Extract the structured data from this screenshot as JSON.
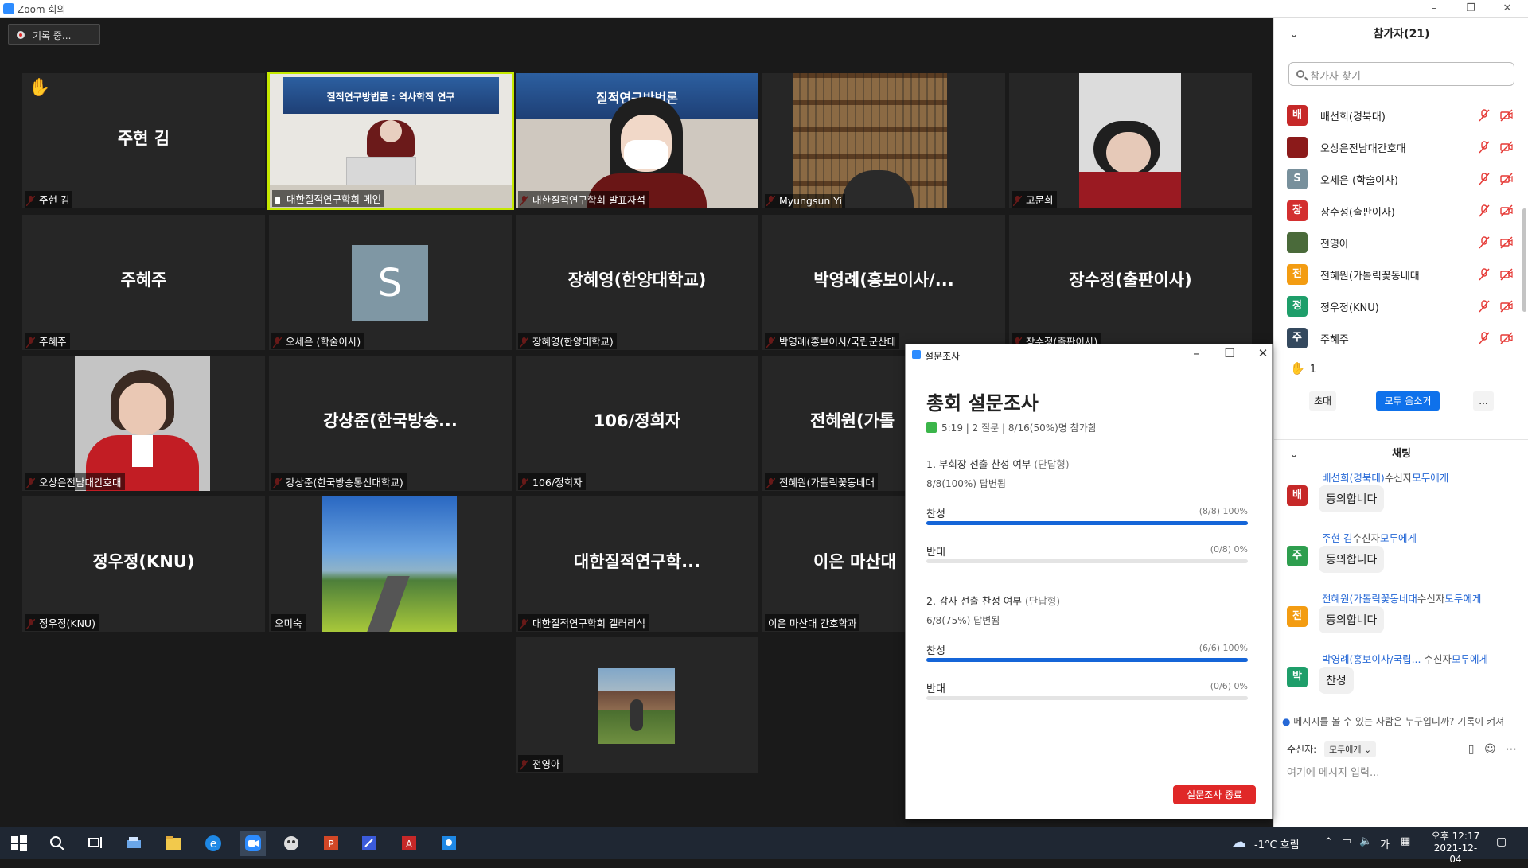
{
  "window": {
    "title": "Zoom 회의",
    "minimize": "–",
    "restore": "❐",
    "close": "✕"
  },
  "recording": {
    "label": "기록 중..."
  },
  "tiles": [
    {
      "big": "주현 김",
      "name": "주현 김",
      "muted": true,
      "hand": true
    },
    {
      "name": "대한질적연구학회 메인",
      "muted": false,
      "active": true,
      "banner": "질적연구방법론 : 역사학적 연구"
    },
    {
      "name": "대한질적연구학회 발표자석",
      "muted": true,
      "banner": "질적연구방법론",
      "banner2": "연구"
    },
    {
      "name": "Myungsun Yi",
      "muted": true
    },
    {
      "name": "고문희",
      "muted": true
    },
    {
      "big": "주혜주",
      "name": "주혜주",
      "muted": true
    },
    {
      "avatar_letter": "S",
      "name": "오세은 (학술이사)",
      "muted": true
    },
    {
      "big": "장혜영(한양대학교)",
      "name": "장혜영(한양대학교)",
      "muted": true
    },
    {
      "big": "박영례(홍보이사/...",
      "name": "박영례(홍보이사/국립군산대",
      "muted": true
    },
    {
      "big": "장수정(출판이사)",
      "name": "장수정(출판이사)",
      "muted": true
    },
    {
      "name": "오상은전남대간호대",
      "muted": true
    },
    {
      "big": "강상준(한국방송...",
      "name": "강상준(한국방송통신대학교)",
      "muted": true
    },
    {
      "big": "106/정희자",
      "name": "106/정희자",
      "muted": true
    },
    {
      "big": "전혜원(가톨",
      "name": "전혜원(가톨릭꽃동네대",
      "muted": true
    },
    {
      "big": "정우정(KNU)",
      "name": "정우정(KNU)",
      "muted": true
    },
    {
      "name": "오미숙",
      "muted": false
    },
    {
      "big": "대한질적연구학...",
      "name": "대한질적연구학회 갤러리석",
      "muted": true
    },
    {
      "big": "이은 마산대",
      "name": "이은 마산대 간호학과",
      "muted": false
    },
    {
      "name": "전영아",
      "muted": true
    }
  ],
  "participants": {
    "header": "참가자(21)",
    "search_placeholder": "참가자 찾기",
    "list": [
      {
        "initial": "배",
        "name": "배선희(경북대)",
        "color": "#c62828"
      },
      {
        "initial": "",
        "name": "오상은전남대간호대",
        "color": "#8b1a1a"
      },
      {
        "initial": "S",
        "name": "오세은 (학술이사)",
        "color": "#78909c"
      },
      {
        "initial": "장",
        "name": "장수정(출판이사)",
        "color": "#d32f2f"
      },
      {
        "initial": "",
        "name": "전영아",
        "color": "#4a6a3a"
      },
      {
        "initial": "전",
        "name": "전혜원(가톨릭꽃동네대",
        "color": "#f39c12"
      },
      {
        "initial": "정",
        "name": "정우정(KNU)",
        "color": "#1e9e6a"
      },
      {
        "initial": "주",
        "name": "주혜주",
        "color": "#34495e"
      }
    ],
    "hands_count": "1",
    "invite": "초대",
    "mute_all": "모두 음소거",
    "more": "..."
  },
  "chat": {
    "header": "채팅",
    "messages": [
      {
        "initial": "배",
        "color": "#c62828",
        "from": "배선희(경북대)",
        "to_label": "수신자",
        "to": "모두에게",
        "text": "동의합니다"
      },
      {
        "initial": "주",
        "color": "#2e9e4e",
        "from": "주현 김",
        "to_label": "수신자",
        "to": "모두에게",
        "text": "동의합니다"
      },
      {
        "initial": "전",
        "color": "#f39c12",
        "from": "전혜원(가톨릭꽃동네대",
        "to_label": "수신자",
        "to": "모두에게",
        "text": "동의합니다"
      },
      {
        "initial": "박",
        "color": "#1e9e6a",
        "from": "박영례(홍보이사/국립...",
        "to_label": " 수신자",
        "to": "모두에게",
        "text": "찬성"
      }
    ],
    "note": "메시지를 볼 수 있는 사람은 누구입니까? 기록이 켜져",
    "to_label": "수신자:",
    "to_value": "모두에게",
    "input_placeholder": "여기에 메시지 입력..."
  },
  "poll": {
    "window_title": "설문조사",
    "title": "총회 설문조사",
    "meta": "5:19  |  2 질문  |  8/16(50%)명 참가함",
    "questions": [
      {
        "title": "1. 부회장 선출 찬성 여부",
        "type": "(단답형)",
        "answered": "8/8(100%) 답변됨",
        "options": [
          {
            "label": "찬성",
            "value_text": "(8/8) 100%",
            "fraction": 1.0
          },
          {
            "label": "반대",
            "value_text": "(0/8) 0%",
            "fraction": 0.0
          }
        ]
      },
      {
        "title": "2. 감사 선출 찬성 여부",
        "type": "(단답형)",
        "answered": "6/8(75%) 답변됨",
        "options": [
          {
            "label": "찬성",
            "value_text": "(6/6) 100%",
            "fraction": 1.0
          },
          {
            "label": "반대",
            "value_text": "(0/6) 0%",
            "fraction": 0.0
          }
        ]
      }
    ],
    "end_button": "설문조사 종료"
  },
  "taskbar": {
    "weather": "-1°C  흐림",
    "ime": "가",
    "time": "오후 12:17",
    "date": "2021-12-04"
  }
}
